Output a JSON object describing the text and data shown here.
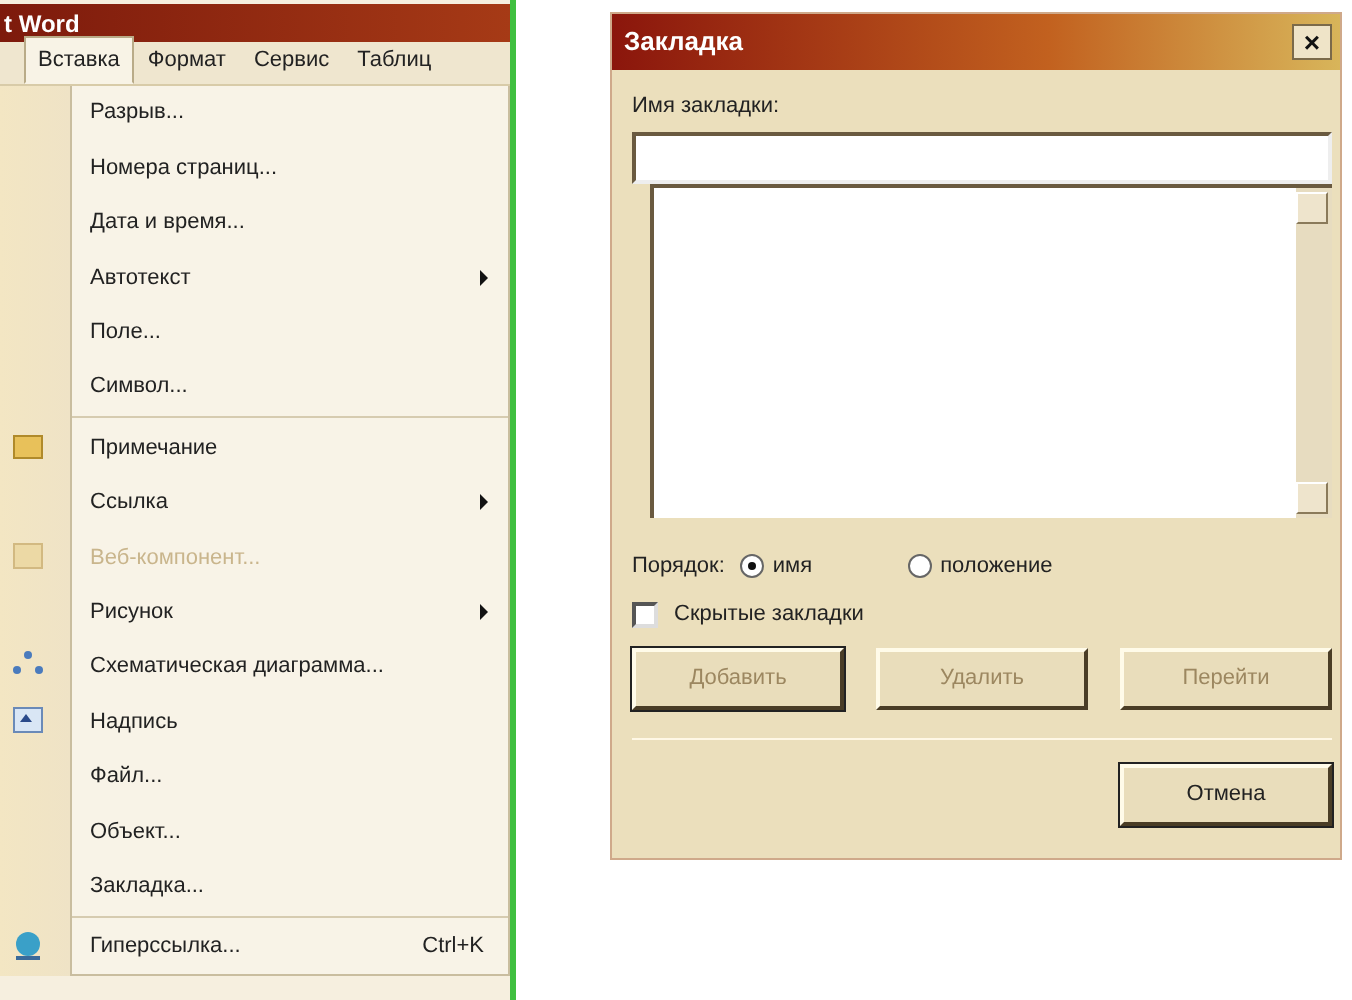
{
  "app_window": {
    "title": "t Word",
    "menu_bar": [
      {
        "label": "Вставка",
        "selected": true
      },
      {
        "label": "Формат",
        "selected": false
      },
      {
        "label": "Сервис",
        "selected": false
      },
      {
        "label": "Таблиц",
        "selected": false
      }
    ],
    "menu": [
      {
        "label": "Разрыв...",
        "kind": "item",
        "disabled": false,
        "submenu": false
      },
      {
        "label": "Номера страниц...",
        "kind": "item",
        "disabled": false,
        "submenu": false
      },
      {
        "label": "Дата и время...",
        "kind": "item",
        "disabled": false,
        "submenu": false
      },
      {
        "label": "Автотекст",
        "kind": "item",
        "disabled": false,
        "submenu": true
      },
      {
        "label": "Поле...",
        "kind": "item",
        "disabled": false,
        "submenu": false
      },
      {
        "label": "Символ...",
        "kind": "item",
        "disabled": false,
        "submenu": false
      },
      {
        "kind": "separator"
      },
      {
        "label": "Примечание",
        "kind": "item",
        "disabled": false,
        "submenu": false
      },
      {
        "label": "Ссылка",
        "kind": "item",
        "disabled": false,
        "submenu": true
      },
      {
        "label": "Веб-компонент...",
        "kind": "item",
        "disabled": true,
        "submenu": false
      },
      {
        "label": "Рисунок",
        "kind": "item",
        "disabled": false,
        "submenu": true
      },
      {
        "label": "Схематическая диаграмма...",
        "kind": "item",
        "disabled": false,
        "submenu": false
      },
      {
        "label": "Надпись",
        "kind": "item",
        "disabled": false,
        "submenu": false
      },
      {
        "label": "Файл...",
        "kind": "item",
        "disabled": false,
        "submenu": false
      },
      {
        "label": "Объект...",
        "kind": "item",
        "disabled": false,
        "submenu": false
      },
      {
        "label": "Закладка...",
        "kind": "item",
        "disabled": false,
        "submenu": false
      },
      {
        "kind": "separator"
      },
      {
        "label": "Гиперссылка...",
        "kind": "item",
        "shortcut": "Ctrl+K",
        "disabled": false,
        "submenu": false
      }
    ]
  },
  "dialog": {
    "title": "Закладка",
    "close": "×",
    "name_label": "Имя закладки:",
    "order_label": "Порядок:",
    "order_options": [
      {
        "label": "имя",
        "selected": true
      },
      {
        "label": "положение",
        "selected": false
      }
    ],
    "hidden_bookmarks": {
      "label": "Скрытые закладки",
      "checked": false
    },
    "buttons": [
      {
        "label": "Добавить",
        "disabled": true,
        "default": true
      },
      {
        "label": "Удалить",
        "disabled": true,
        "default": false
      },
      {
        "label": "Перейти",
        "disabled": true,
        "default": false
      }
    ],
    "cancel": "Отмена"
  }
}
